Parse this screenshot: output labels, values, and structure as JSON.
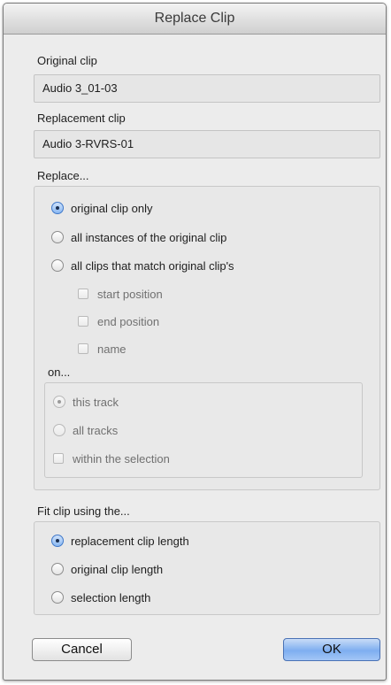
{
  "dialog": {
    "title": "Replace Clip"
  },
  "original_clip": {
    "label": "Original clip",
    "value": "Audio 3_01-03"
  },
  "replacement_clip": {
    "label": "Replacement clip",
    "value": "Audio 3-RVRS-01"
  },
  "replace": {
    "label": "Replace...",
    "options": [
      {
        "label": "original clip only",
        "checked": true
      },
      {
        "label": "all instances of the original clip",
        "checked": false
      },
      {
        "label": "all clips that match original clip's",
        "checked": false
      }
    ],
    "match_criteria": [
      {
        "label": "start position",
        "checked": false
      },
      {
        "label": "end position",
        "checked": false
      },
      {
        "label": "name",
        "checked": false
      }
    ],
    "on": {
      "label": "on...",
      "options": [
        {
          "label": "this track",
          "checked": true
        },
        {
          "label": "all tracks",
          "checked": false
        }
      ],
      "within_selection": {
        "label": "within the selection",
        "checked": false
      }
    }
  },
  "fit": {
    "label": "Fit clip using the...",
    "options": [
      {
        "label": "replacement clip length",
        "checked": true
      },
      {
        "label": "original clip length",
        "checked": false
      },
      {
        "label": "selection length",
        "checked": false
      }
    ]
  },
  "buttons": {
    "cancel": "Cancel",
    "ok": "OK"
  },
  "colors": {
    "window_bg": "#ececec",
    "accent": "#7eaef0"
  }
}
